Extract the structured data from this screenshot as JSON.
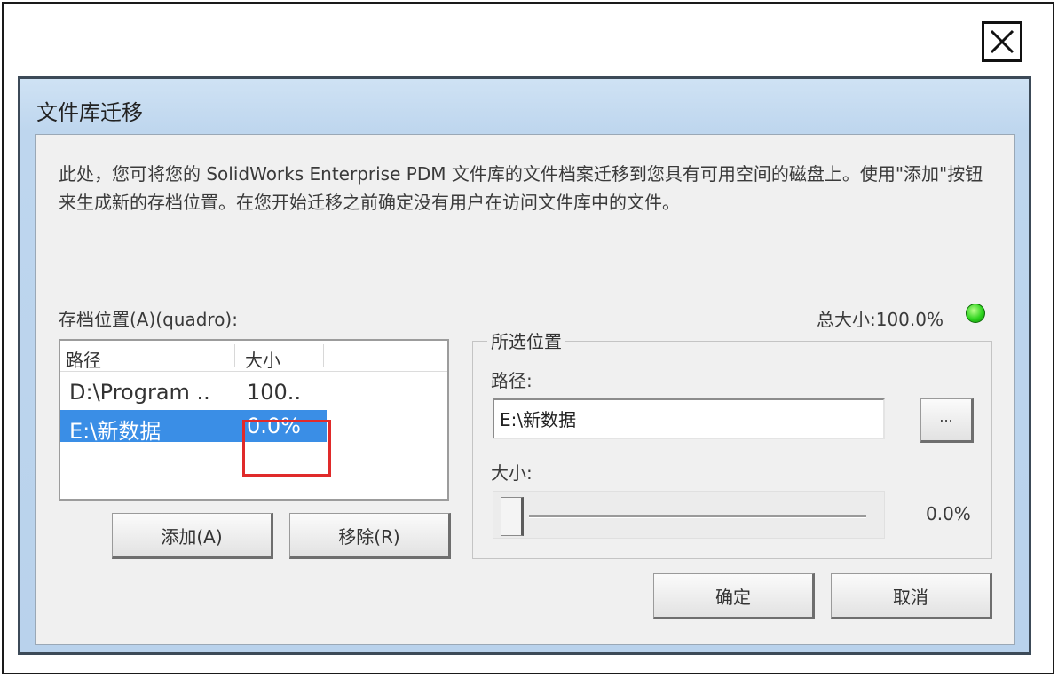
{
  "dialog": {
    "title": "文件库迁移",
    "description": "此处，您可将您的 SolidWorks Enterprise PDM 文件库的文件档案迁移到您具有可用空间的磁盘上。使用\"添加\"按钮来生成新的存档位置。在您开始迁移之前确定没有用户在访问文件库中的文件。",
    "archive_label": "存档位置(A)(quadro):",
    "total_size_label": "总大小:100.0%",
    "total_size_status_color": "#2dd41e",
    "list": {
      "columns": [
        "路径",
        "大小"
      ],
      "rows": [
        {
          "path": "D:\\Program ..",
          "size": "100.."
        },
        {
          "path": "E:\\新数据",
          "size": "0.0%"
        }
      ],
      "selected_index": 1
    },
    "add_button": "添加(A)",
    "remove_button": "移除(R)",
    "selected_group": {
      "legend": "所选位置",
      "path_label": "路径:",
      "path_value": "E:\\新数据",
      "browse_button": "...",
      "size_label": "大小:",
      "size_value": "0.0%",
      "size_fraction": 0.0
    },
    "ok_button": "确定",
    "cancel_button": "取消"
  },
  "colors": {
    "title_bar": "#bed6ee",
    "selection": "#3a8ee6",
    "annotation_box": "#e02a2a"
  },
  "icons": {
    "close": "close-icon"
  }
}
